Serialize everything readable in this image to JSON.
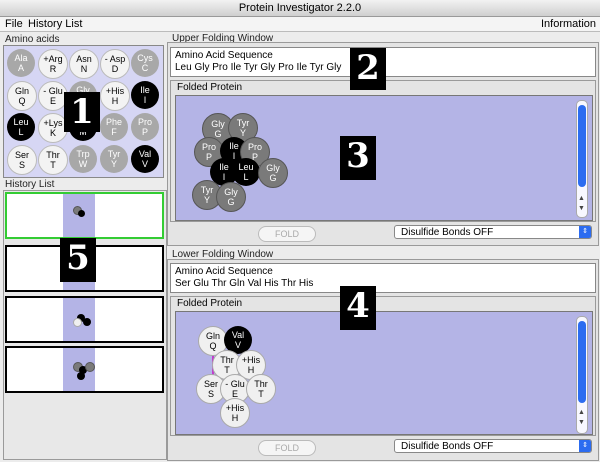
{
  "window": {
    "title": "Protein Investigator 2.2.0"
  },
  "menu": {
    "file": "File",
    "history": "History List",
    "info": "Information"
  },
  "amino_acids": {
    "label": "Amino acids",
    "items": [
      {
        "top": "Ala",
        "bottom": "A",
        "style": "mid"
      },
      {
        "top": "+Arg",
        "bottom": "R",
        "style": "light"
      },
      {
        "top": "Asn",
        "bottom": "N",
        "style": "light"
      },
      {
        "top": "- Asp",
        "bottom": "D",
        "style": "light"
      },
      {
        "top": "Cys",
        "bottom": "C",
        "style": "mid"
      },
      {
        "top": "Gln",
        "bottom": "Q",
        "style": "light"
      },
      {
        "top": "- Glu",
        "bottom": "E",
        "style": "light"
      },
      {
        "top": "Gly",
        "bottom": "G",
        "style": "mid"
      },
      {
        "top": "+His",
        "bottom": "H",
        "style": "light"
      },
      {
        "top": "Ile",
        "bottom": "I",
        "style": "dark"
      },
      {
        "top": "Leu",
        "bottom": "L",
        "style": "dark"
      },
      {
        "top": "+Lys",
        "bottom": "K",
        "style": "light"
      },
      {
        "top": "Met",
        "bottom": "M",
        "style": "dark"
      },
      {
        "top": "Phe",
        "bottom": "F",
        "style": "mid"
      },
      {
        "top": "Pro",
        "bottom": "P",
        "style": "mid"
      },
      {
        "top": "Ser",
        "bottom": "S",
        "style": "light"
      },
      {
        "top": "Thr",
        "bottom": "T",
        "style": "light"
      },
      {
        "top": "Trp",
        "bottom": "W",
        "style": "mid"
      },
      {
        "top": "Tyr",
        "bottom": "Y",
        "style": "mid"
      },
      {
        "top": "Val",
        "bottom": "V",
        "style": "dark"
      }
    ]
  },
  "history": {
    "label": "History List"
  },
  "upper": {
    "label": "Upper Folding Window",
    "seq_label": "Amino Acid Sequence",
    "sequence": "Leu Gly Pro Ile Tyr Gly Pro Ile Tyr Gly",
    "folded_label": "Folded Protein",
    "fold_button": "FOLD",
    "disulfide": "Disulfide Bonds OFF"
  },
  "lower": {
    "label": "Lower Folding Window",
    "seq_label": "Amino Acid Sequence",
    "sequence": "Ser Glu Thr Gln Val His Thr His",
    "folded_label": "Folded Protein",
    "fold_button": "FOLD",
    "disulfide": "Disulfide Bonds OFF"
  },
  "badges": {
    "b1": "1",
    "b2": "2",
    "b3": "3",
    "b4": "4",
    "b5": "5"
  },
  "icons": {
    "scroll_up": "▲",
    "scroll_down": "▼",
    "select_arrow": "⇕"
  },
  "colors": {
    "panel_blue": "#b4b4e6",
    "bond": "#c33ccc",
    "scroll": "#2c6cf0"
  }
}
